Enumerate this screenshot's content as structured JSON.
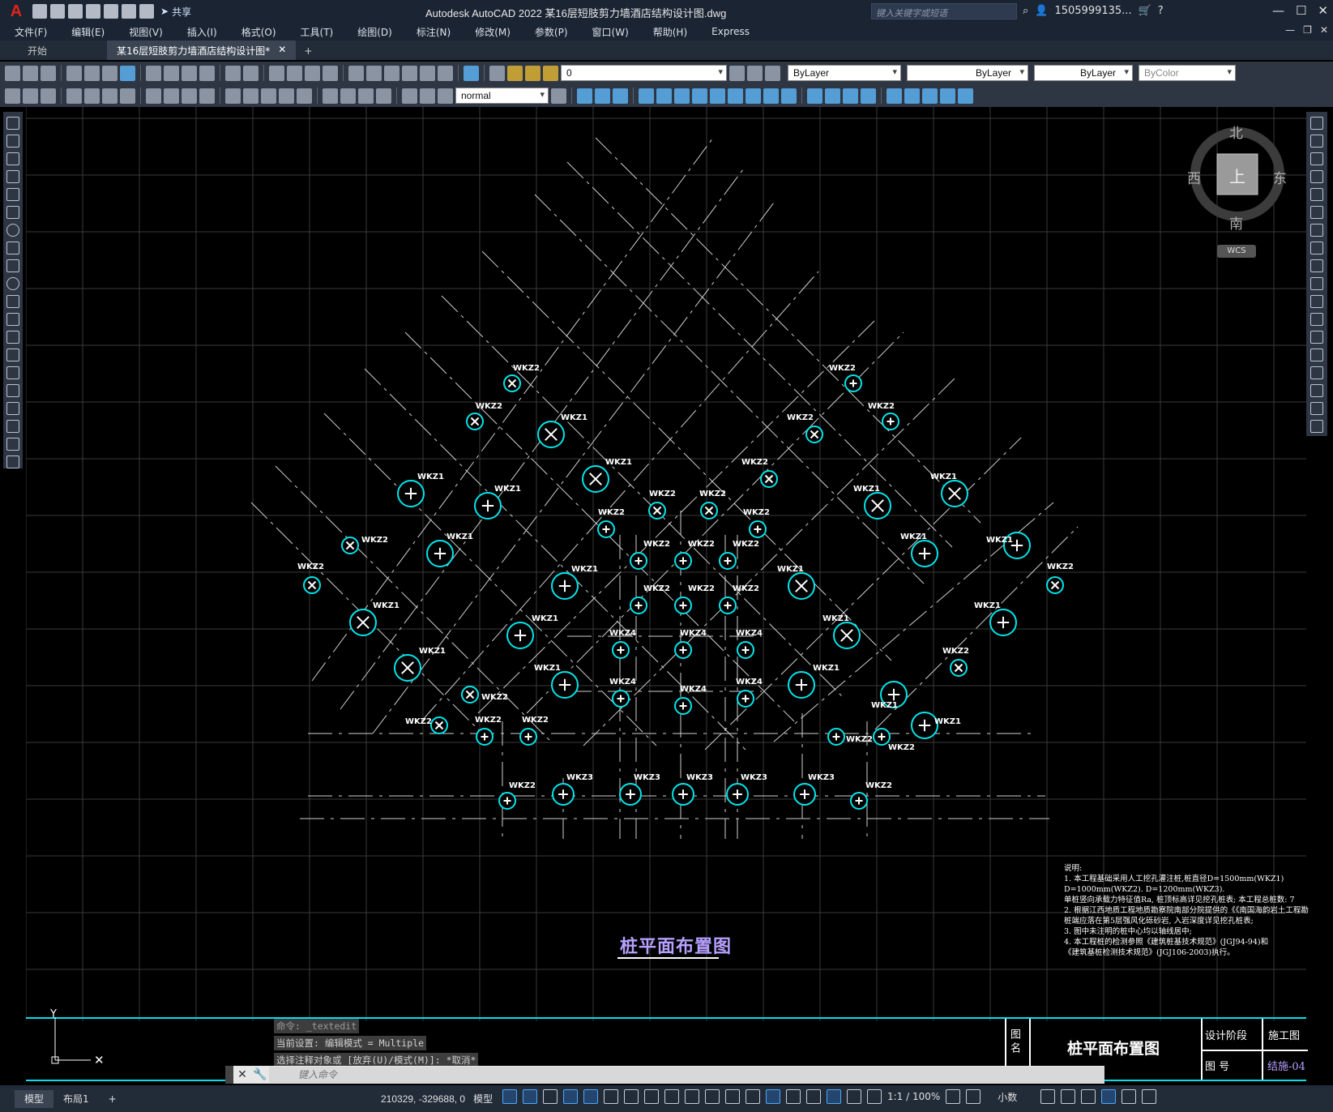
{
  "app": {
    "title": "Autodesk AutoCAD 2022    某16层短肢剪力墙酒店结构设计图.dwg",
    "search_placeholder": "键入关键字或短语",
    "user": "1505999135...",
    "share": "共享"
  },
  "menu": [
    "文件(F)",
    "编辑(E)",
    "视图(V)",
    "插入(I)",
    "格式(O)",
    "工具(T)",
    "绘图(D)",
    "标注(N)",
    "修改(M)",
    "参数(P)",
    "窗口(W)",
    "帮助(H)",
    "Express"
  ],
  "tabs": {
    "start": "开始",
    "active": "某16层短肢剪力墙酒店结构设计图*"
  },
  "toolbar": {
    "layer": "0",
    "color": "ByLayer",
    "linetype": "ByLayer",
    "lineweight": "ByLayer",
    "plotstyle": "ByColor",
    "textstyle": "normal"
  },
  "viewcube": {
    "north": "北",
    "south": "南",
    "east": "东",
    "west": "西",
    "top": "上",
    "wcs": "WCS"
  },
  "drawing": {
    "title": "桩平面布置图",
    "piles": [
      {
        "label": "WKZ2",
        "kind": "x",
        "size": "s"
      },
      {
        "label": "WKZ2",
        "kind": "x",
        "size": "s"
      },
      {
        "label": "WKZ1",
        "kind": "x",
        "size": "l"
      },
      {
        "label": "WKZ1",
        "kind": "x",
        "size": "l"
      },
      {
        "label": "WKZ1",
        "kind": "+",
        "size": "l"
      },
      {
        "label": "WKZ1",
        "kind": "+",
        "size": "l"
      },
      {
        "label": "WKZ2",
        "kind": "x",
        "size": "s"
      },
      {
        "label": "WKZ1",
        "kind": "+",
        "size": "l"
      },
      {
        "label": "WKZ2",
        "kind": "x",
        "size": "s"
      },
      {
        "label": "WKZ1",
        "kind": "x",
        "size": "l"
      },
      {
        "label": "WKZ1",
        "kind": "x",
        "size": "l"
      },
      {
        "label": "WKZ1",
        "kind": "+",
        "size": "l"
      },
      {
        "label": "WKZ1",
        "kind": "+",
        "size": "l"
      },
      {
        "label": "WKZ1",
        "kind": "+",
        "size": "l"
      },
      {
        "label": "WKZ2",
        "kind": "x",
        "size": "s"
      },
      {
        "label": "WKZ2",
        "kind": "x",
        "size": "s"
      },
      {
        "label": "WKZ2",
        "kind": "+",
        "size": "s"
      },
      {
        "label": "WKZ2",
        "kind": "+",
        "size": "s"
      },
      {
        "label": "WKZ2",
        "kind": "x",
        "size": "s"
      },
      {
        "label": "WKZ2",
        "kind": "x",
        "size": "s"
      },
      {
        "label": "WKZ1",
        "kind": "x",
        "size": "l"
      },
      {
        "label": "WKZ1",
        "kind": "x",
        "size": "l"
      },
      {
        "label": "WKZ1",
        "kind": "+",
        "size": "l"
      },
      {
        "label": "WKZ1",
        "kind": "+",
        "size": "l"
      },
      {
        "label": "WKZ2",
        "kind": "x",
        "size": "s"
      },
      {
        "label": "WKZ1",
        "kind": "+",
        "size": "l"
      },
      {
        "label": "WKZ2",
        "kind": "x",
        "size": "s"
      },
      {
        "label": "WKZ1",
        "kind": "x",
        "size": "l"
      },
      {
        "label": "WKZ1",
        "kind": "x",
        "size": "l"
      },
      {
        "label": "WKZ1",
        "kind": "+",
        "size": "l"
      },
      {
        "label": "WKZ1",
        "kind": "+",
        "size": "l"
      },
      {
        "label": "WKZ1",
        "kind": "+",
        "size": "l"
      },
      {
        "label": "WKZ2",
        "kind": "x",
        "size": "s"
      },
      {
        "label": "WKZ2",
        "kind": "x",
        "size": "s"
      },
      {
        "label": "WKZ2",
        "kind": "+",
        "size": "s"
      },
      {
        "label": "WKZ2",
        "kind": "+",
        "size": "s"
      },
      {
        "label": "WKZ2",
        "kind": "+",
        "size": "s"
      },
      {
        "label": "WKZ2",
        "kind": "+",
        "size": "s"
      },
      {
        "label": "WKZ2",
        "kind": "+",
        "size": "s"
      },
      {
        "label": "WKZ2",
        "kind": "+",
        "size": "s"
      },
      {
        "label": "WKZ2",
        "kind": "+",
        "size": "s"
      },
      {
        "label": "WKZ2",
        "kind": "+",
        "size": "s"
      },
      {
        "label": "WKZ2",
        "kind": "+",
        "size": "s"
      },
      {
        "label": "WKZ2",
        "kind": "+",
        "size": "s"
      },
      {
        "label": "WKZ2",
        "kind": "+",
        "size": "s"
      },
      {
        "label": "WKZ2",
        "kind": "+",
        "size": "s"
      },
      {
        "label": "WKZ4",
        "kind": "+",
        "size": "s"
      },
      {
        "label": "WKZ4",
        "kind": "+",
        "size": "s"
      },
      {
        "label": "WKZ4",
        "kind": "+",
        "size": "s"
      },
      {
        "label": "WKZ4",
        "kind": "+",
        "size": "s"
      },
      {
        "label": "WKZ4",
        "kind": "+",
        "size": "s"
      },
      {
        "label": "WKZ4",
        "kind": "+",
        "size": "s"
      },
      {
        "label": "WKZ2",
        "kind": "+",
        "size": "s"
      },
      {
        "label": "WKZ3",
        "kind": "+",
        "size": "m"
      },
      {
        "label": "WKZ3",
        "kind": "+",
        "size": "m"
      },
      {
        "label": "WKZ3",
        "kind": "+",
        "size": "m"
      },
      {
        "label": "WKZ3",
        "kind": "+",
        "size": "m"
      },
      {
        "label": "WKZ3",
        "kind": "+",
        "size": "m"
      },
      {
        "label": "WKZ2",
        "kind": "+",
        "size": "s"
      }
    ],
    "notes": [
      "说明:",
      "1. 本工程基础采用人工挖孔灌注桩,桩直径D=1500mm(WKZ1)",
      "   D=1000mm(WKZ2). D=1200mm(WKZ3).",
      "   单桩竖向承载力特征值Ra, 桩顶标高详见挖孔桩表; 本工程总桩数: 7",
      "2. 根据江西地质工程地质勘察院南部分院提供的《《南国海韵岩土工程勘",
      "   桩端应落在第5层强风化砾砂岩, 入岩深度详见挖孔桩表;",
      "3. 图中未注明的桩中心均以轴线居中;",
      "4. 本工程桩的检测参照《建筑桩基技术规范》(JGJ94-94)和",
      "   《建筑基桩检测技术规范》(JGJ106-2003)执行。"
    ]
  },
  "titleblock": {
    "label_name": "图 名",
    "name": "桩平面布置图",
    "label_stage": "设计阶段",
    "stage": "施工图",
    "label_number": "图 号",
    "number": "结施-04"
  },
  "command": {
    "line1": "命令: _textedit",
    "line2": "当前设置: 编辑模式 = Multiple",
    "line3": "选择注释对象或 [放弃(U)/模式(M)]: *取消*",
    "placeholder": "键入命令"
  },
  "status": {
    "model_tab": "模型",
    "layout_tab": "布局1",
    "coords": "210329, -329688, 0",
    "space": "模型",
    "scale": "1:1 / 100%",
    "units": "小数"
  },
  "colors": {
    "pile": "#00e5ea",
    "grid": "#3a3a3a",
    "axis": "#d0d0d0",
    "title": "#b7a0ff"
  }
}
